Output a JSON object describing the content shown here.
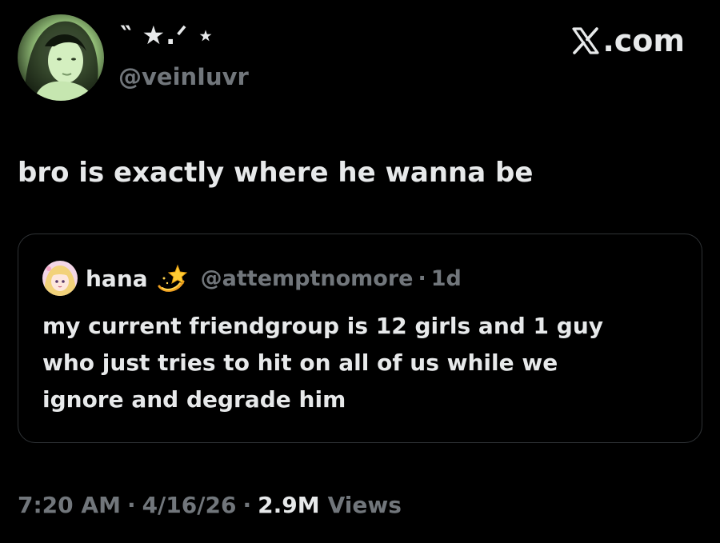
{
  "author": {
    "display_name": "‶ ★.ᐟ ⋆",
    "username": "@veinIuvr",
    "avatar_icon": "profile-avatar-icon"
  },
  "brand": {
    "text": ".com",
    "icon": "x-logo-icon"
  },
  "tweet": {
    "text": "bro is exactly where he wanna be"
  },
  "quoted_tweet": {
    "name": "hana",
    "emoji_icon": "shooting-star-emoji-icon",
    "handle": "@attemptnomore",
    "separator": "·",
    "time": "1d",
    "lines": [
      "my current friendgroup is 12 girls and 1 guy",
      "who just tries to hit on all of us while we",
      "ignore and degrade him"
    ]
  },
  "meta": {
    "time": "7:20 AM",
    "separator": "·",
    "date": "4/16/26",
    "views_count": "2.9M",
    "views_label": "Views"
  },
  "colors": {
    "background": "#000000",
    "primary_text": "#e7e9ea",
    "secondary_text": "#71767b",
    "border": "#2f3336",
    "avatar_tint": "#b7e3a0"
  }
}
